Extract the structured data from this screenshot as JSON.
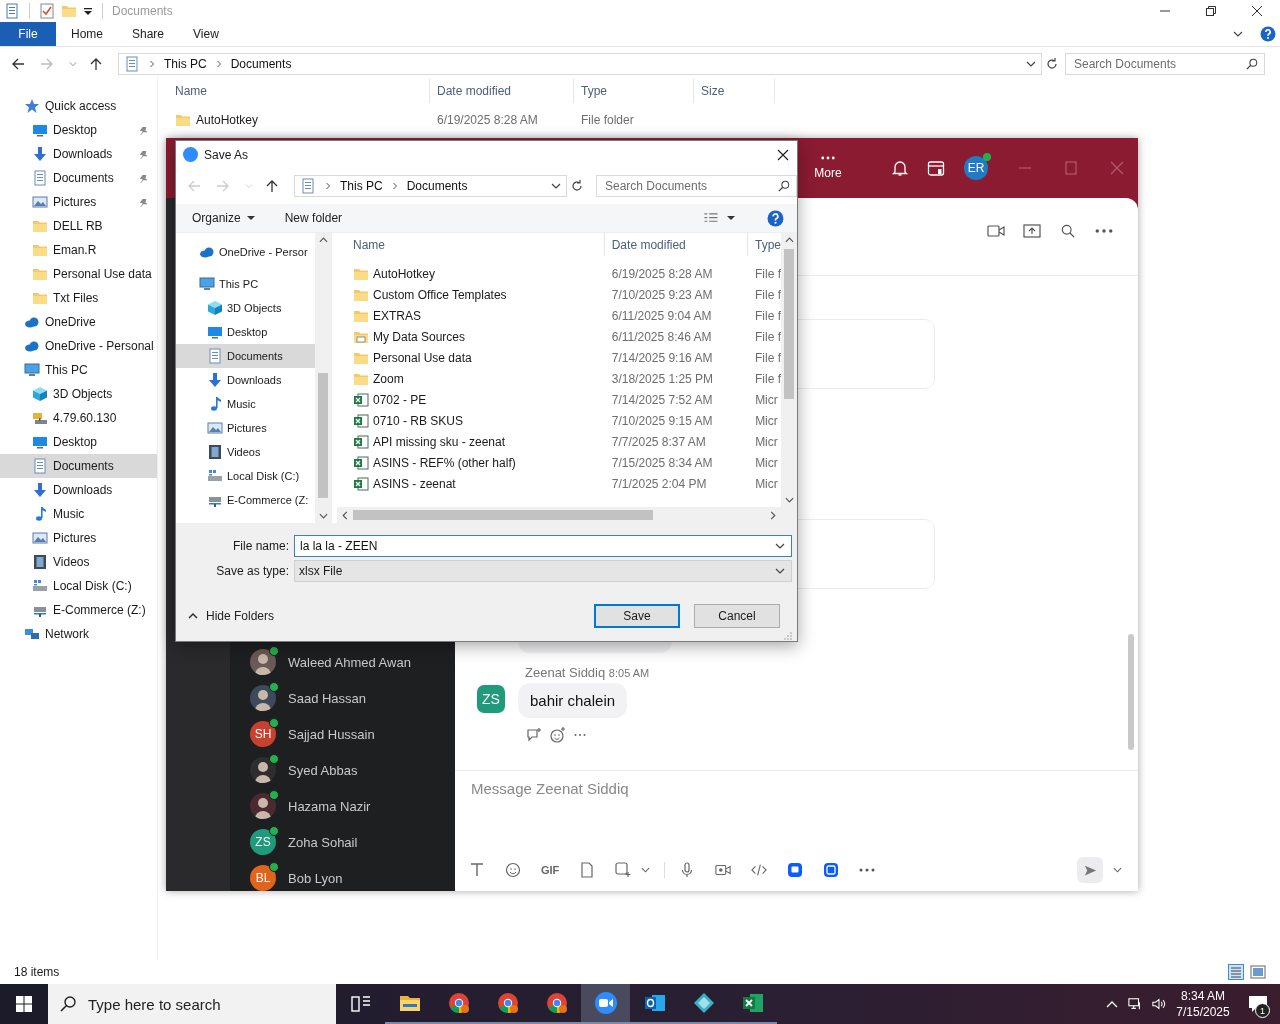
{
  "explorer": {
    "title": "Documents",
    "ribbon_tabs": [
      {
        "label": "File",
        "selected": true
      },
      {
        "label": "Home",
        "selected": false
      },
      {
        "label": "Share",
        "selected": false
      },
      {
        "label": "View",
        "selected": false
      }
    ],
    "address": [
      "This PC",
      "Documents"
    ],
    "search": {
      "placeholder": "Search Documents"
    },
    "nav": [
      {
        "label": "Quick access",
        "kind": "star",
        "pinned": false,
        "selected": false,
        "children": [
          {
            "label": "Desktop",
            "kind": "desktop",
            "pinned": true,
            "selected": false
          },
          {
            "label": "Downloads",
            "kind": "download",
            "pinned": true,
            "selected": false
          },
          {
            "label": "Documents",
            "kind": "doc",
            "pinned": true,
            "selected": false
          },
          {
            "label": "Pictures",
            "kind": "pictures",
            "pinned": true,
            "selected": false
          },
          {
            "label": "DELL RB",
            "kind": "folder",
            "pinned": false,
            "selected": false
          },
          {
            "label": "Eman.R",
            "kind": "folder",
            "pinned": false,
            "selected": false
          },
          {
            "label": "Personal Use data",
            "kind": "folder",
            "pinned": false,
            "selected": false
          },
          {
            "label": "Txt Files",
            "kind": "folder",
            "pinned": false,
            "selected": false
          }
        ]
      },
      {
        "label": "OneDrive",
        "kind": "cloud",
        "pinned": false,
        "selected": false
      },
      {
        "label": "OneDrive - Personal",
        "kind": "cloud",
        "pinned": false,
        "selected": false
      },
      {
        "label": "This PC",
        "kind": "pc",
        "pinned": false,
        "selected": false,
        "children": [
          {
            "label": "3D Objects",
            "kind": "cube",
            "pinned": false,
            "selected": false
          },
          {
            "label": "4.79.60.130",
            "kind": "netdrive",
            "pinned": false,
            "selected": false
          },
          {
            "label": "Desktop",
            "kind": "desktop",
            "pinned": false,
            "selected": false
          },
          {
            "label": "Documents",
            "kind": "doc",
            "pinned": false,
            "selected": true
          },
          {
            "label": "Downloads",
            "kind": "download",
            "pinned": false,
            "selected": false
          },
          {
            "label": "Music",
            "kind": "music",
            "pinned": false,
            "selected": false
          },
          {
            "label": "Pictures",
            "kind": "pictures",
            "pinned": false,
            "selected": false
          },
          {
            "label": "Videos",
            "kind": "video",
            "pinned": false,
            "selected": false
          },
          {
            "label": "Local Disk (C:)",
            "kind": "disk",
            "pinned": false,
            "selected": false
          },
          {
            "label": "E-Commerce (Z:)",
            "kind": "netdisk",
            "pinned": false,
            "selected": false
          }
        ]
      },
      {
        "label": "Network",
        "kind": "network",
        "pinned": false,
        "selected": false
      }
    ],
    "columns": [
      "Name",
      "Date modified",
      "Type",
      "Size"
    ],
    "rows": [
      {
        "name": "AutoHotkey",
        "date": "6/19/2025 8:28 AM",
        "type": "File folder",
        "kind": "folder"
      }
    ],
    "status": "18 items"
  },
  "zoom": {
    "more_label": "More",
    "user_initials": "ER",
    "user_online": true,
    "contacts": [
      {
        "name": "Waleed Ahmed Awan",
        "kind": "photo",
        "color": "#6b5a55",
        "online": true
      },
      {
        "name": "Saad Hassan",
        "kind": "photo",
        "color": "#3d4a5c",
        "online": true
      },
      {
        "name": "Sajjad Hussain",
        "kind": "initials",
        "initials": "SH",
        "color": "#c8402f",
        "online": true
      },
      {
        "name": "Syed Abbas",
        "kind": "photo",
        "color": "#2e2e2e",
        "online": true
      },
      {
        "name": "Hazama Nazir",
        "kind": "photo",
        "color": "#4a2a30",
        "online": true
      },
      {
        "name": "Zoha Sohail",
        "kind": "initials",
        "initials": "ZS",
        "color": "#1f9a7a",
        "online": true
      },
      {
        "name": "Bob Lyon",
        "kind": "initials",
        "initials": "BL",
        "color": "#e0641b",
        "online": true
      }
    ],
    "chat": {
      "sender": "Zeenat Siddiq",
      "time": "8:05 AM",
      "initials": "ZS",
      "message": "bahir chalein",
      "composer_placeholder": "Message Zeenat Siddiq",
      "gif_label": "GIF"
    }
  },
  "dialog": {
    "title": "Save As",
    "address": [
      "This PC",
      "Documents"
    ],
    "search": {
      "placeholder": "Search Documents"
    },
    "organize": "Organize",
    "new_folder": "New folder",
    "nav": [
      {
        "label": "OneDrive - Persor",
        "kind": "cloud",
        "selected": false
      },
      {
        "label": "This PC",
        "kind": "pc",
        "selected": false,
        "children": [
          {
            "label": "3D Objects",
            "kind": "cube",
            "selected": false
          },
          {
            "label": "Desktop",
            "kind": "desktop",
            "selected": false
          },
          {
            "label": "Documents",
            "kind": "doc",
            "selected": true
          },
          {
            "label": "Downloads",
            "kind": "download",
            "selected": false
          },
          {
            "label": "Music",
            "kind": "music",
            "selected": false
          },
          {
            "label": "Pictures",
            "kind": "pictures",
            "selected": false
          },
          {
            "label": "Videos",
            "kind": "video",
            "selected": false
          },
          {
            "label": "Local Disk (C:)",
            "kind": "disk",
            "selected": false
          },
          {
            "label": "E-Commerce (Z:",
            "kind": "netdisk",
            "selected": false
          }
        ]
      }
    ],
    "columns": [
      "Name",
      "Date modified",
      "Type"
    ],
    "rows": [
      {
        "name": "AutoHotkey",
        "date": "6/19/2025 8:28 AM",
        "type": "File f",
        "kind": "folder"
      },
      {
        "name": "Custom Office Templates",
        "date": "7/10/2025 9:23 AM",
        "type": "File f",
        "kind": "folder"
      },
      {
        "name": "EXTRAS",
        "date": "6/11/2025 9:04 AM",
        "type": "File f",
        "kind": "folder"
      },
      {
        "name": "My Data Sources",
        "date": "6/11/2025 8:46 AM",
        "type": "File f",
        "kind": "special"
      },
      {
        "name": "Personal Use data",
        "date": "7/14/2025 9:16 AM",
        "type": "File f",
        "kind": "folder"
      },
      {
        "name": "Zoom",
        "date": "3/18/2025 1:25 PM",
        "type": "File f",
        "kind": "folder"
      },
      {
        "name": "0702 - PE",
        "date": "7/14/2025 7:52 AM",
        "type": "Micr",
        "kind": "excel"
      },
      {
        "name": "0710 - RB SKUS",
        "date": "7/10/2025 9:15 AM",
        "type": "Micr",
        "kind": "excel"
      },
      {
        "name": "API missing sku - zeenat",
        "date": "7/7/2025 8:37 AM",
        "type": "Micr",
        "kind": "excel"
      },
      {
        "name": "ASINS - REF% (other half)",
        "date": "7/15/2025 8:34 AM",
        "type": "Micr",
        "kind": "excel"
      },
      {
        "name": "ASINS - zeenat",
        "date": "7/1/2025 2:04 PM",
        "type": "Micr",
        "kind": "excel"
      }
    ],
    "file_name_label": "File name:",
    "file_name": "la la la - ZEEN",
    "type_label": "Save as type:",
    "save_as_type": "xlsx File",
    "hide_folders": "Hide Folders",
    "buttons": [
      {
        "label": "Save",
        "default": true
      },
      {
        "label": "Cancel",
        "default": false
      }
    ]
  },
  "taskbar": {
    "search_placeholder": "Type here to search",
    "apps": [
      {
        "kind": "taskview",
        "running": false,
        "selected": false
      },
      {
        "kind": "explorer",
        "running": true,
        "selected": false
      },
      {
        "kind": "chrome",
        "running": true,
        "selected": false
      },
      {
        "kind": "chrome",
        "running": true,
        "selected": false
      },
      {
        "kind": "chrome",
        "running": true,
        "selected": false
      },
      {
        "kind": "zoom",
        "running": true,
        "selected": true
      },
      {
        "kind": "outlook",
        "running": true,
        "selected": false
      },
      {
        "kind": "gem",
        "running": true,
        "selected": false
      },
      {
        "kind": "excel",
        "running": true,
        "selected": false
      }
    ],
    "time": "8:34 AM",
    "date": "7/15/2025",
    "notifications": "1"
  }
}
